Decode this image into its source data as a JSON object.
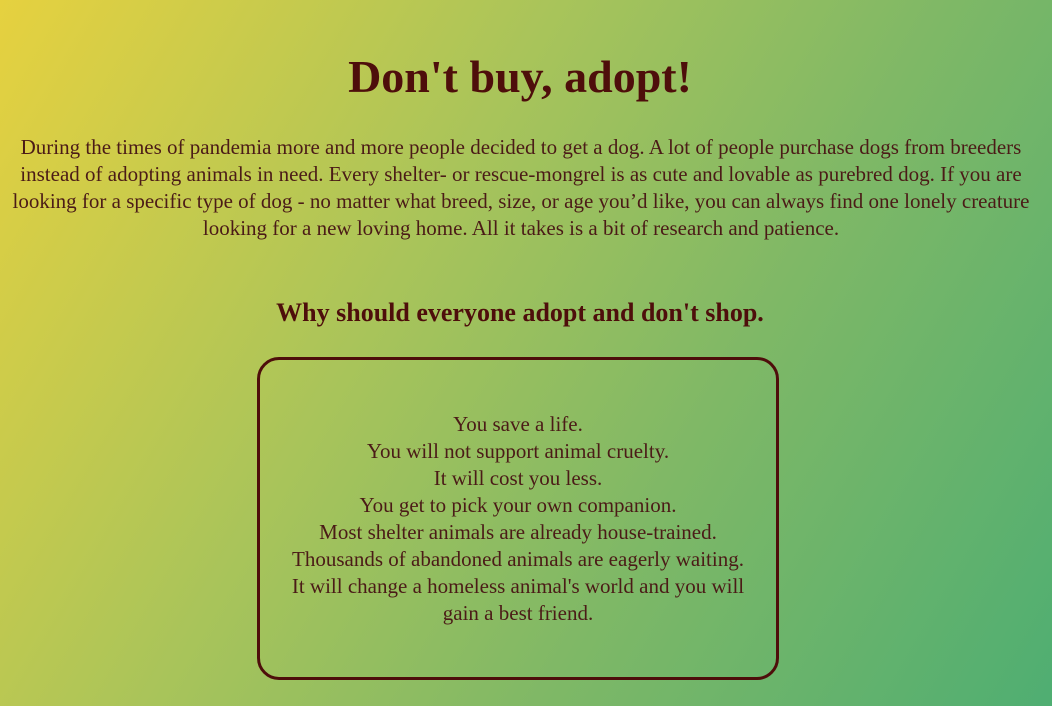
{
  "title": "Don't buy, adopt!",
  "intro": "During the times of pandemia more and more people decided to get a dog. A lot of people purchase dogs from breeders instead of adopting animals in need. Every shelter- or rescue-mongrel is as cute and lovable as purebred dog. If you are looking for a specific type of dog - no matter what breed, size, or age you’d like, you can always find one lonely creature looking for a new loving home. All it takes is a bit of research and patience.",
  "subtitle": "Why should everyone adopt and don't shop.",
  "reasons": [
    "You save a life.",
    "You will not support animal cruelty.",
    "It will cost you less.",
    "You get to pick your own companion.",
    "Most shelter animals are already house-trained.",
    "Thousands of abandoned animals are eagerly waiting.",
    "It will change a homeless animal's world and you will gain a best friend."
  ],
  "colors": {
    "heading": "#4e0e0b",
    "text": "#4b1b17",
    "gradient_start": "#e6d13f",
    "gradient_end": "#4fae72"
  }
}
